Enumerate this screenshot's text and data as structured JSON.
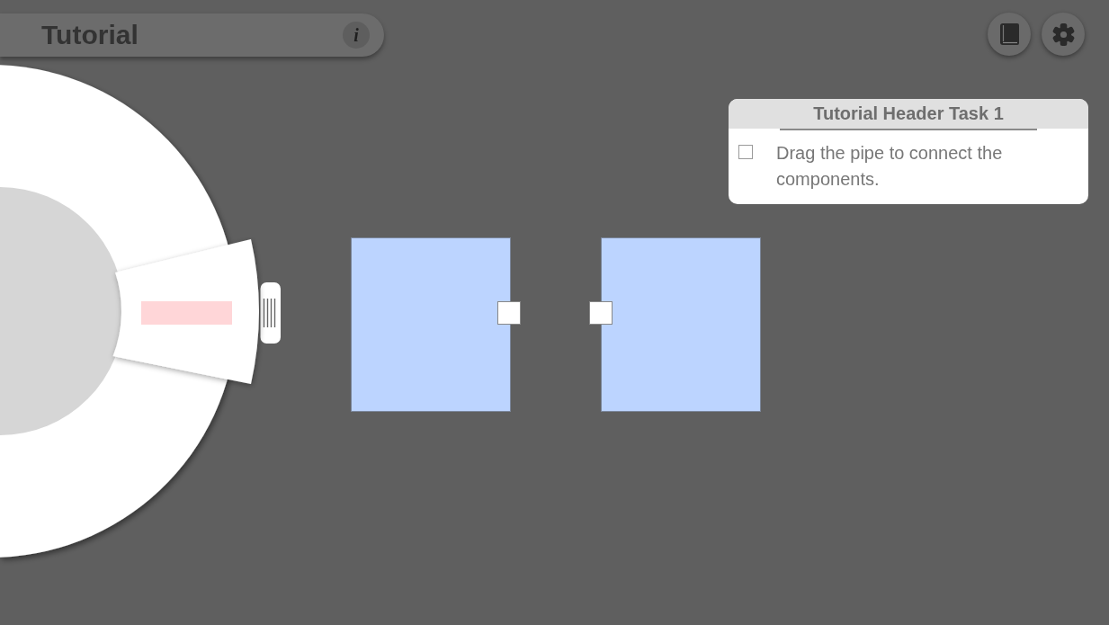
{
  "title_bar": {
    "title": "Tutorial",
    "info_icon": "i"
  },
  "task_panel": {
    "title": "Tutorial Header Task 1",
    "tasks": [
      {
        "text": "Drag the pipe to connect the components.",
        "checked": false
      }
    ]
  }
}
